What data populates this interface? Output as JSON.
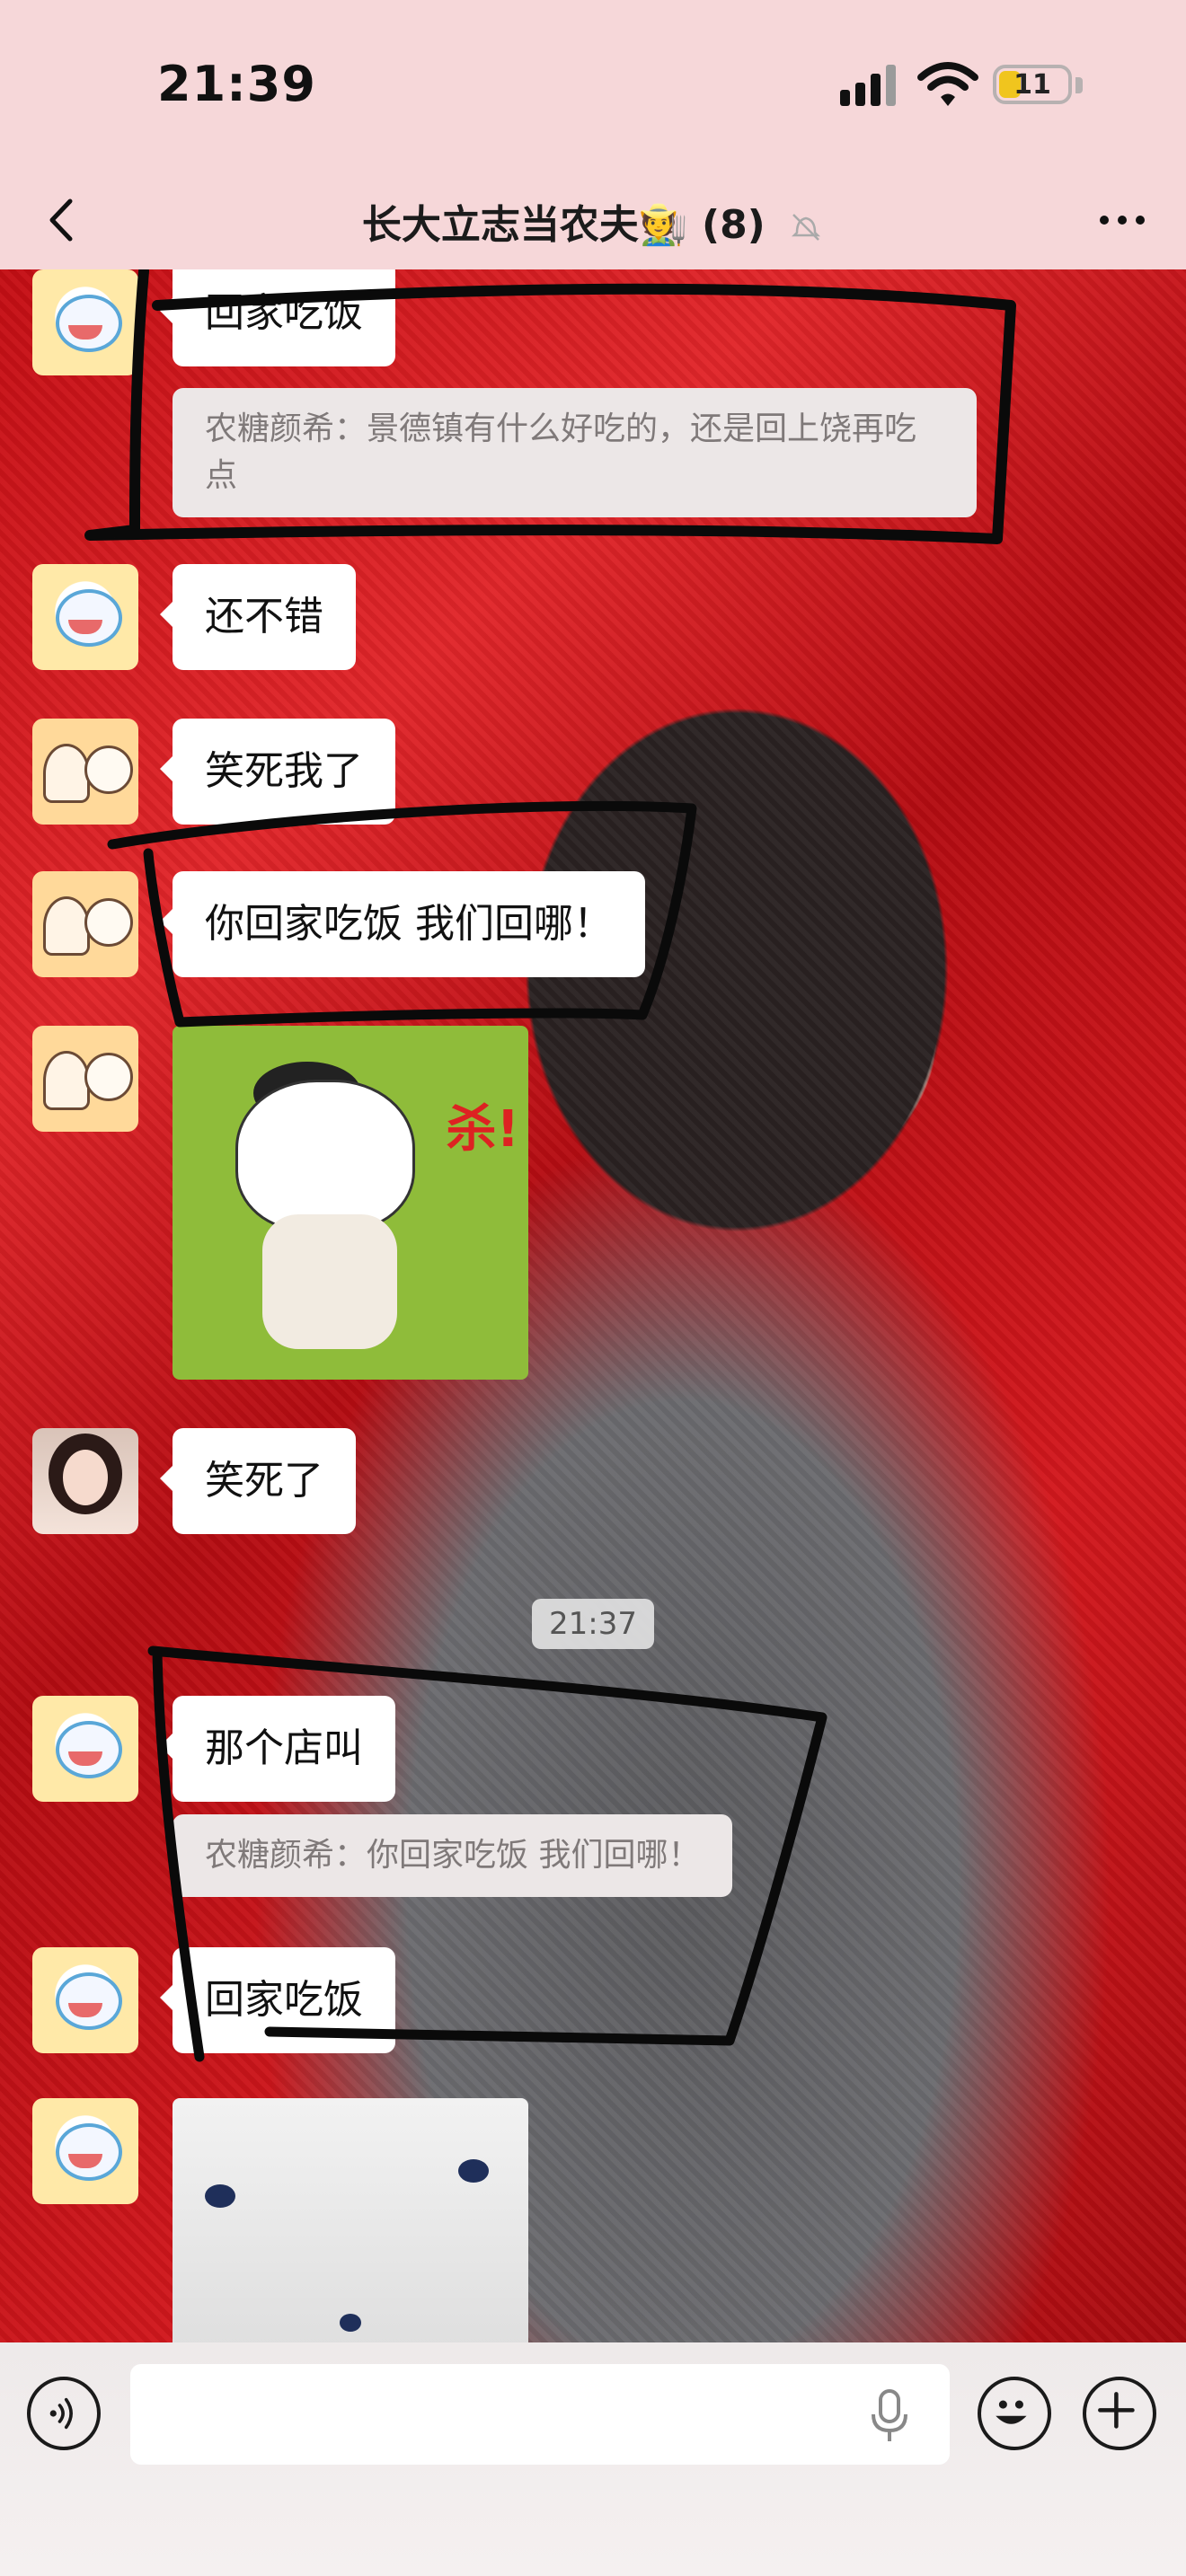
{
  "status_bar": {
    "time": "21:39",
    "battery": "11"
  },
  "header": {
    "title": "长大立志当农夫🧑‍🌾 (8)"
  },
  "messages": [
    {
      "text": "回家吃饭",
      "quote": "农糖颜希：景德镇有什么好吃的，还是回上饶再吃点"
    },
    {
      "text": "还不错"
    },
    {
      "text": "笑死我了"
    },
    {
      "text": "你回家吃饭 我们回哪！"
    },
    {
      "sticker": "cow-sticker",
      "caption": "杀!"
    },
    {
      "text": "笑死了"
    },
    {
      "text": "那个店叫",
      "quote": "农糖颜希：你回家吃饭 我们回哪！"
    },
    {
      "text": "回家吃饭"
    },
    {
      "sticker": "plush-photo"
    }
  ],
  "timestamp": "21:37",
  "input": {
    "value": "",
    "placeholder": ""
  },
  "icons": {
    "back": "chevron-left-icon",
    "mute": "bell-slash-icon",
    "more": "ellipsis-icon",
    "voice": "voice-icon",
    "mic": "microphone-icon",
    "emoji": "emoji-icon",
    "plus": "plus-icon"
  }
}
